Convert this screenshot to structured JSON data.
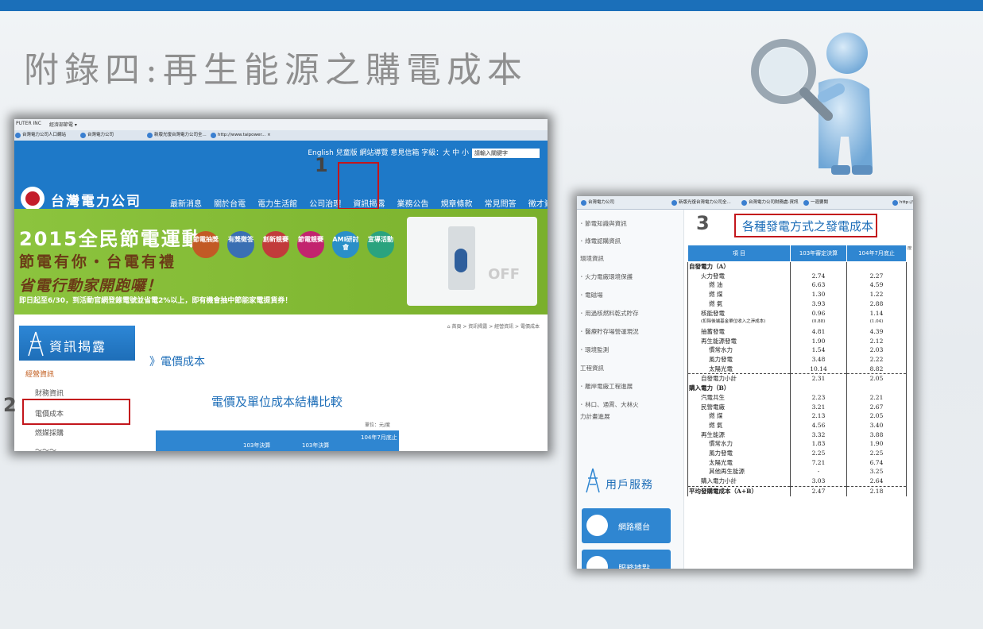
{
  "slide": {
    "title": "附錄四:再生能源之購電成本"
  },
  "colors": {
    "top_bar": "#1b6fb9",
    "accent_blue": "#1e79c8",
    "highlight_red": "#c3161c",
    "banner_green": "#8cc43e"
  },
  "markers": {
    "step1": "1",
    "step2": "2",
    "step3": "3"
  },
  "shot1": {
    "ie_bar": [
      "PUTER INC",
      "經濟部節電 ▾"
    ],
    "tabs": [
      "台灣電力公司人口網站",
      "台灣電力公司",
      "新版光復台灣電力公司全...",
      "http://www.taipower... ×"
    ],
    "header": {
      "util_links": "English  兒童版  網站導覽  意見信箱  字級：大  中  小",
      "search_placeholder": "請輸入關鍵字",
      "logo": "台灣電力公司",
      "nav": [
        "最新消息",
        "關於台電",
        "電力生活館",
        "公司治理",
        "資訊揭露",
        "業務公告",
        "規章條款",
        "常見問答",
        "徵才資訊"
      ]
    },
    "banner": {
      "line1": "2015全民節電運動",
      "line2": "節電有你・台電有禮",
      "line3": "省電行動家開跑囉！",
      "line4": "即日起至6/30，到活動官網登錄電號並省電2%以上，即有機會抽中節能家電提貨券！",
      "badges": [
        "節電抽獎",
        "有獎徵答",
        "創新競賽",
        "節電競賽",
        "AMI研討會",
        "宣導活動"
      ],
      "off_text": "OFF"
    },
    "breadcrumb": "⌂ 首頁 > 資訊揭露 > 經營資訊 > 電價成本",
    "sidebar": {
      "heading": "資訊揭露",
      "items": [
        "經營資訊",
        "財務資訊",
        "電價成本",
        "燃媒採購",
        "～～～"
      ]
    },
    "content": {
      "title": "》電價成本",
      "subtitle": "電價及單位成本結構比較",
      "unit": "單位：元/度",
      "table_headers": [
        "103年決算",
        "103年決算",
        "104年7月底止"
      ]
    }
  },
  "shot2": {
    "tabs": [
      "台灣電力公司",
      "新版光復台灣電力公司全...",
      "台灣電力公司財務處-資訊",
      "一週要聞",
      "http://"
    ],
    "left_menu": [
      "･ 節電知識與資訊",
      "･ 綠電認購資訊",
      "環境資訊",
      "･ 火力電廠環境保護",
      "･ 電磁場",
      "･ 用過核燃料乾式貯存",
      "･ 醫療貯存場營運現況",
      "･ 環境監測",
      "工程資訊",
      "･ 離岸電廠工程進展",
      "･ 林口、通霄、大林火",
      "  力計畫進展"
    ],
    "user_service": "用戶服務",
    "buttons": [
      "網路櫃台",
      "服務據點"
    ],
    "title": "各種發電方式之發電成本",
    "unit": "單位:元/度",
    "headers": [
      "項  目",
      "103年審定決算",
      "104年7月底止"
    ],
    "rows": [
      {
        "label": "自發電力（A）",
        "a": "",
        "b": ""
      },
      {
        "label": "火力發電",
        "a": "2.74",
        "b": "2.27"
      },
      {
        "label": "燃  油",
        "a": "6.63",
        "b": "4.59"
      },
      {
        "label": "燃  煤",
        "a": "1.30",
        "b": "1.22"
      },
      {
        "label": "燃  氣",
        "a": "3.93",
        "b": "2.88"
      },
      {
        "label": "核能發電",
        "a": "0.96",
        "b": "1.14"
      },
      {
        "label": "(扣除後端基金單位收入之淨成本)",
        "a": "(0.88)",
        "b": "(1.04)"
      },
      {
        "label": "抽蓄發電",
        "a": "4.81",
        "b": "4.39"
      },
      {
        "label": "再生能源發電",
        "a": "1.90",
        "b": "2.12"
      },
      {
        "label": "慣常水力",
        "a": "1.54",
        "b": "2.03"
      },
      {
        "label": "風力發電",
        "a": "3.48",
        "b": "2.22"
      },
      {
        "label": "太陽光電",
        "a": "10.14",
        "b": "8.82"
      },
      {
        "label": "自發電力小計",
        "a": "2.31",
        "b": "2.05"
      },
      {
        "label": "購入電力（B）",
        "a": "",
        "b": ""
      },
      {
        "label": "汽電共生",
        "a": "2.23",
        "b": "2.21"
      },
      {
        "label": "民營電廠",
        "a": "3.21",
        "b": "2.67"
      },
      {
        "label": "燃  煤",
        "a": "2.13",
        "b": "2.05"
      },
      {
        "label": "燃  氣",
        "a": "4.56",
        "b": "3.40"
      },
      {
        "label": "再生能源",
        "a": "3.32",
        "b": "3.88"
      },
      {
        "label": "慣常水力",
        "a": "1.83",
        "b": "1.90"
      },
      {
        "label": "風力發電",
        "a": "2.25",
        "b": "2.25"
      },
      {
        "label": "太陽光電",
        "a": "7.21",
        "b": "6.74"
      },
      {
        "label": "其他再生能源",
        "a": "-",
        "b": "3.25"
      },
      {
        "label": "購入電力小計",
        "a": "3.03",
        "b": "2.64"
      },
      {
        "label": "平均發購電成本（A+B）",
        "a": "2.47",
        "b": "2.18"
      }
    ]
  }
}
